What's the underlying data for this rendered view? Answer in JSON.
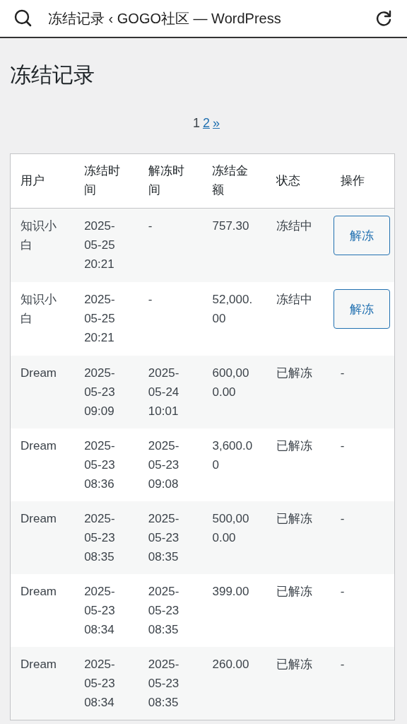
{
  "browser_bar": {
    "title": "冻结记录 ‹ GOGO社区 — WordPress"
  },
  "page_title": "冻结记录",
  "pagination": [
    {
      "label": "1",
      "selected": true
    },
    {
      "label": "2",
      "selected": false
    },
    {
      "label": "»",
      "selected": false
    }
  ],
  "table": {
    "columns": [
      "用户",
      "冻结时间",
      "解冻时间",
      "冻结金额",
      "状态",
      "操作"
    ],
    "rows": [
      {
        "user": "知识小白",
        "frozen_at": "2025-05-25 20:21",
        "unfrozen_at": "-",
        "amount": "757.30",
        "status": "冻结中",
        "action": {
          "kind": "button",
          "label": "解冻"
        }
      },
      {
        "user": "知识小白",
        "frozen_at": "2025-05-25 20:21",
        "unfrozen_at": "-",
        "amount": "52,000.00",
        "status": "冻结中",
        "action": {
          "kind": "button",
          "label": "解冻"
        }
      },
      {
        "user": "Dream",
        "frozen_at": "2025-05-23 09:09",
        "unfrozen_at": "2025-05-24 10:01",
        "amount": "600,000.00",
        "status": "已解冻",
        "action": {
          "kind": "text",
          "label": "-"
        }
      },
      {
        "user": "Dream",
        "frozen_at": "2025-05-23 08:36",
        "unfrozen_at": "2025-05-23 09:08",
        "amount": "3,600.00",
        "status": "已解冻",
        "action": {
          "kind": "text",
          "label": "-"
        }
      },
      {
        "user": "Dream",
        "frozen_at": "2025-05-23 08:35",
        "unfrozen_at": "2025-05-23 08:35",
        "amount": "500,000.00",
        "status": "已解冻",
        "action": {
          "kind": "text",
          "label": "-"
        }
      },
      {
        "user": "Dream",
        "frozen_at": "2025-05-23 08:34",
        "unfrozen_at": "2025-05-23 08:35",
        "amount": "399.00",
        "status": "已解冻",
        "action": {
          "kind": "text",
          "label": "-"
        }
      },
      {
        "user": "Dream",
        "frozen_at": "2025-05-23 08:34",
        "unfrozen_at": "2025-05-23 08:35",
        "amount": "260.00",
        "status": "已解冻",
        "action": {
          "kind": "text",
          "label": "-"
        }
      }
    ]
  }
}
